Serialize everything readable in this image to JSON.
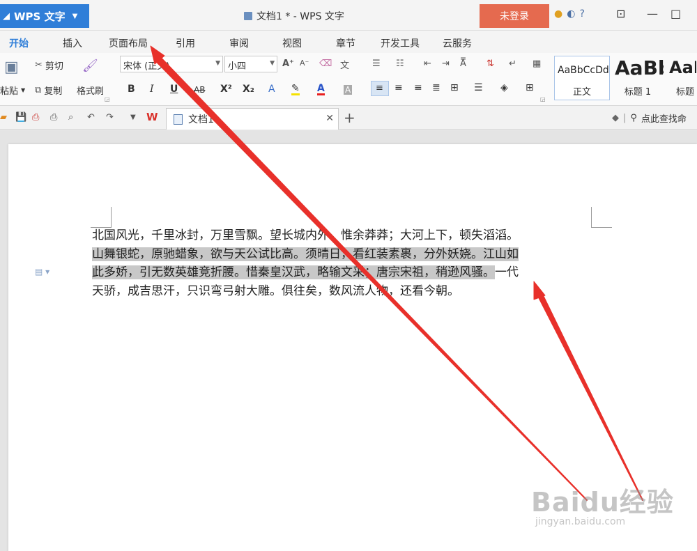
{
  "titlebar": {
    "app_name": "WPS 文字",
    "doc_title": "文档1 * - WPS 文字",
    "login_label": "未登录"
  },
  "ribbon_tabs": [
    "开始",
    "插入",
    "页面布局",
    "引用",
    "审阅",
    "视图",
    "章节",
    "开发工具",
    "云服务"
  ],
  "active_tab": "开始",
  "clipboard": {
    "paste_label": "粘贴",
    "cut_label": "剪切",
    "copy_label": "复制",
    "format_painter_label": "格式刷"
  },
  "font": {
    "family": "宋体 (正文)",
    "size": "小四"
  },
  "styles": {
    "normal_preview": "AaBbCcDd",
    "normal_name": "正文",
    "h1_preview": "AaBb",
    "h1_name": "标题 1",
    "h2_preview": "AaB",
    "h2_name": "标题"
  },
  "doc_tab": {
    "label": "文档1"
  },
  "search": {
    "placeholder": "点此查找命"
  },
  "document": {
    "lines": [
      {
        "plain": "北国风光，千里冰封，万里雪飘。望长城内外，惟余莽莽；大河上下，顿失滔滔。",
        "highlight": ""
      },
      {
        "plain": "",
        "highlight": "山舞银蛇，原驰蜡象，欲与天公试比高。须晴日，看红装素裹，分外妖娆。江山如"
      },
      {
        "plain": "",
        "highlight": "此多娇，引无数英雄竞折腰。惜秦皇汉武，略输文采；唐宗宋祖，稍逊风骚。",
        "tail": "一代"
      },
      {
        "plain": "天骄，成吉思汗，只识弯弓射大雕。俱往矣，数风流人物，还看今朝。",
        "highlight": ""
      }
    ]
  },
  "watermark": {
    "main": "Baidu经验",
    "sub": "jingyan.baidu.com"
  },
  "colors": {
    "brand_blue": "#2f7ed8",
    "login_orange": "#e56a4f",
    "annotation_red": "#e8302a"
  }
}
